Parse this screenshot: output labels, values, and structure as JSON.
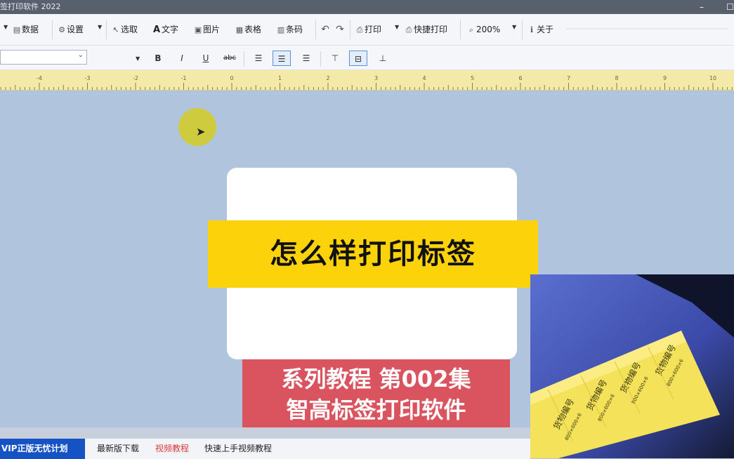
{
  "window": {
    "title": "签打印软件 2022",
    "controls": [
      "–",
      "☐"
    ]
  },
  "toolbar": {
    "items": [
      {
        "key": "data",
        "label": "数据",
        "icon": "database-icon"
      },
      {
        "key": "settings",
        "label": "设置",
        "icon": "settings-icon"
      },
      {
        "key": "select",
        "label": "选取",
        "icon": "pointer-icon"
      },
      {
        "key": "text",
        "label": "文字",
        "icon": "text-icon"
      },
      {
        "key": "image",
        "label": "图片",
        "icon": "image-icon"
      },
      {
        "key": "table",
        "label": "表格",
        "icon": "table-icon"
      },
      {
        "key": "barcode",
        "label": "条码",
        "icon": "barcode-icon"
      },
      {
        "key": "print",
        "label": "打印",
        "icon": "printer-icon"
      },
      {
        "key": "quickprint",
        "label": "快捷打印",
        "icon": "quick-print-icon"
      },
      {
        "key": "zoom",
        "label": "200%",
        "icon": "zoom-icon"
      },
      {
        "key": "about",
        "label": "关于",
        "icon": "info-icon"
      }
    ]
  },
  "format_toolbar": {
    "font_value": "",
    "bold": "B",
    "italic": "I",
    "underline": "U",
    "strike": "abc",
    "align_center_active": true
  },
  "ruler": {
    "labels": [
      "-4",
      "-3",
      "-2",
      "-1",
      "0",
      "1",
      "2",
      "3",
      "4",
      "5",
      "6",
      "7",
      "8",
      "9",
      "10"
    ]
  },
  "overlay": {
    "title": "怎么样打印标签",
    "series_line1": "系列教程 第002集",
    "series_line2": "智高标签打印软件"
  },
  "photo": {
    "label_text": "货物编号",
    "label_code": "800×600×6"
  },
  "footer": {
    "vip": "VIP正版无忧计划",
    "links": [
      {
        "label": "最新版下载",
        "highlight": false
      },
      {
        "label": "视频教程",
        "highlight": true
      },
      {
        "label": "快速上手视频教程",
        "highlight": false
      }
    ]
  },
  "colors": {
    "canvas": "#b0c4de",
    "title_band": "#fcd20a",
    "series_band": "#d9545e",
    "vip": "#1553c5",
    "ruler": "#f3e9a8"
  }
}
